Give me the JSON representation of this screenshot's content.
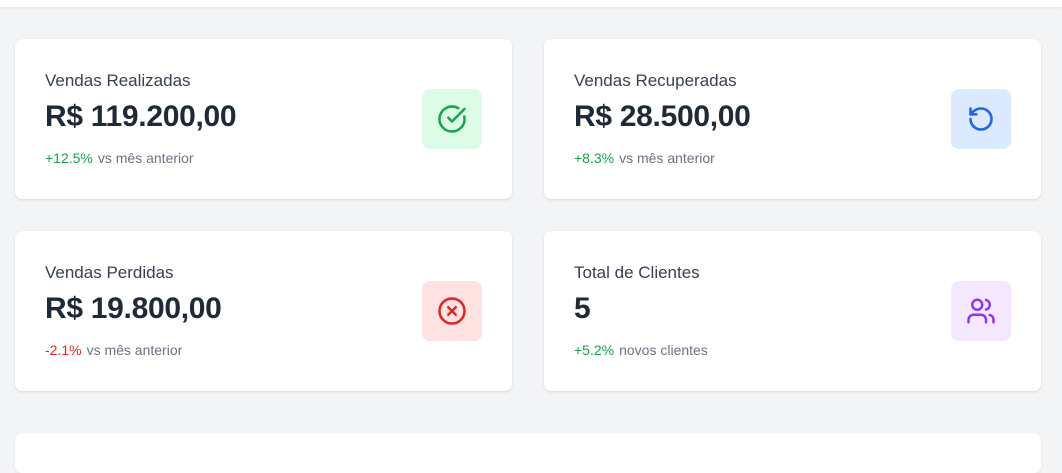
{
  "cards": [
    {
      "title": "Vendas Realizadas",
      "value": "R$ 119.200,00",
      "delta": "+12.5%",
      "note": "vs mês anterior",
      "icon": "check-circle-icon",
      "icon_bg": "#dcfce7",
      "icon_color": "#16a34a",
      "delta_color": "#16a34a"
    },
    {
      "title": "Vendas Recuperadas",
      "value": "R$ 28.500,00",
      "delta": "+8.3%",
      "note": "vs mês anterior",
      "icon": "rotate-ccw-icon",
      "icon_bg": "#dbeafe",
      "icon_color": "#2563eb",
      "delta_color": "#16a34a"
    },
    {
      "title": "Vendas Perdidas",
      "value": "R$ 19.800,00",
      "delta": "-2.1%",
      "note": "vs mês anterior",
      "icon": "x-circle-icon",
      "icon_bg": "#fee2e2",
      "icon_color": "#dc2626",
      "delta_color": "#dc2626"
    },
    {
      "title": "Total de Clientes",
      "value": "5",
      "delta": "+5.2%",
      "note": "novos clientes",
      "icon": "users-icon",
      "icon_bg": "#f3e8ff",
      "icon_color": "#9333ea",
      "delta_color": "#16a34a"
    }
  ]
}
